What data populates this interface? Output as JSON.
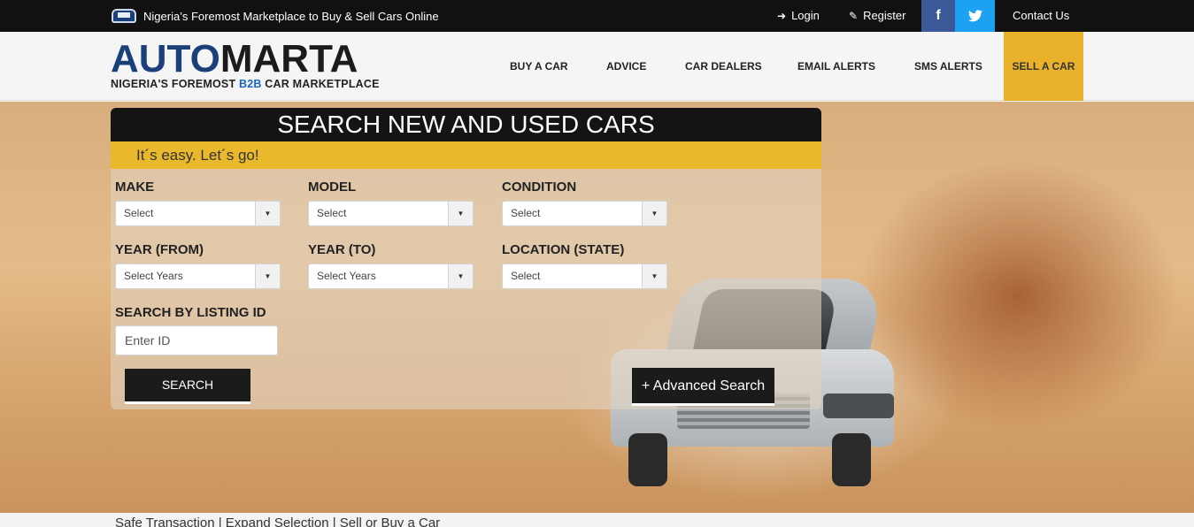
{
  "topbar": {
    "tagline": "Nigeria’s Foremost Marketplace to Buy & Sell Cars Online",
    "login": "Login",
    "register": "Register",
    "facebook": "f",
    "twitter": "🐦",
    "contact": "Contact Us"
  },
  "header": {
    "logo_auto": "AUTO",
    "logo_marta": "MARTA",
    "logo_sub_a": "NIGERIA'S FOREMOST ",
    "logo_sub_b2b": "B2B",
    "logo_sub_b": " CAR MARKETPLACE",
    "nav": [
      "BUY A CAR",
      "ADVICE",
      "CAR DEALERS",
      "EMAIL ALERTS",
      "SMS ALERTS",
      "SELL A CAR"
    ]
  },
  "search": {
    "title": "SEARCH NEW AND USED CARS",
    "tagline": "It´s easy. Let´s go!",
    "make_label": "MAKE",
    "make_value": "Select",
    "model_label": "MODEL",
    "model_value": "Select",
    "condition_label": "CONDITION",
    "condition_value": "Select",
    "year_from_label": "YEAR (FROM)",
    "year_from_value": "Select Years",
    "year_to_label": "YEAR (TO)",
    "year_to_value": "Select Years",
    "location_label": "LOCATION (STATE)",
    "location_value": "Select",
    "listing_id_label": "SEARCH BY LISTING ID",
    "listing_id_placeholder": "Enter ID",
    "search_button": "SEARCH",
    "advanced_button": "+ Advanced Search"
  },
  "footer_strip": "Safe Transaction | Expand Selection | Sell or Buy a Car"
}
